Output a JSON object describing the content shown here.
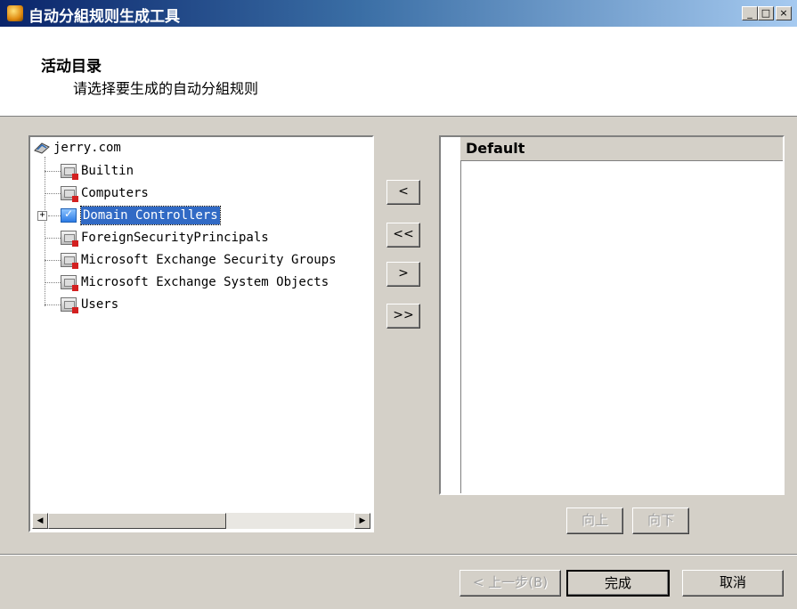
{
  "window": {
    "title": "自动分組规则生成工具",
    "controls": [
      "_",
      "□",
      "×"
    ]
  },
  "header": {
    "title": "活动目录",
    "subtitle": "请选择要生成的自动分組规则"
  },
  "tree": {
    "root": "jerry.com",
    "items": [
      {
        "label": "Builtin",
        "icon": "ou-icon"
      },
      {
        "label": "Computers",
        "icon": "ou-icon"
      },
      {
        "label": "Domain Controllers",
        "icon": "dc-icon",
        "selected": true,
        "expandable": true
      },
      {
        "label": "ForeignSecurityPrincipals",
        "icon": "ou-icon"
      },
      {
        "label": "Microsoft Exchange Security Groups",
        "icon": "ou-icon"
      },
      {
        "label": "Microsoft Exchange System Objects",
        "icon": "ou-icon"
      },
      {
        "label": "Users",
        "icon": "ou-icon"
      }
    ]
  },
  "transfer_buttons": {
    "remove_one": "<",
    "remove_all": "<<",
    "add_one": ">",
    "add_all": ">>"
  },
  "rule_list": {
    "header": "Default"
  },
  "order_buttons": {
    "up": "向上",
    "down": "向下"
  },
  "footer": {
    "back": "< 上一步(B)",
    "finish": "完成",
    "cancel": "取消"
  }
}
